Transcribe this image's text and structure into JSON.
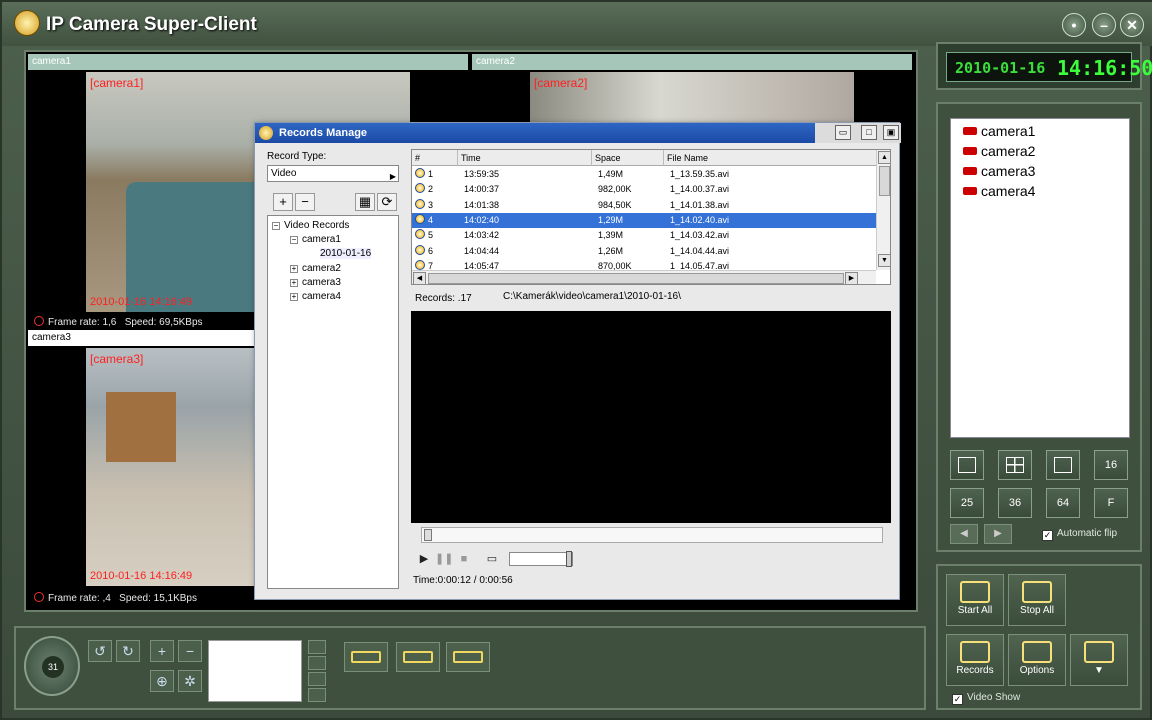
{
  "app": {
    "title": "IP Camera Super-Client"
  },
  "clock": {
    "date": "2010-01-16",
    "time": "14:16:50"
  },
  "cameras": {
    "cam1": {
      "header": "camera1",
      "overlay_label": "[camera1]",
      "timestamp": "2010-01-16 14:16:49",
      "frame_rate": "Frame rate: 1,6",
      "speed": "Speed: 69,5KBps"
    },
    "cam2": {
      "header": "camera2",
      "overlay_label": "[camera2]"
    },
    "cam3": {
      "header": "camera3",
      "overlay_label": "[camera3]",
      "timestamp": "2010-01-16 14:16:49",
      "frame_rate": "Frame rate: ,4",
      "speed": "Speed: 15,1KBps"
    }
  },
  "camera_list": [
    "camera1",
    "camera2",
    "camera3",
    "camera4"
  ],
  "layout_buttons": {
    "b16": "16",
    "b25": "25",
    "b36": "36",
    "b64": "64",
    "bf": "F"
  },
  "automatic_flip": "Automatic flip",
  "actions": {
    "start_all": "Start All",
    "stop_all": "Stop All",
    "records": "Records",
    "options": "Options"
  },
  "video_show": "Video Show",
  "ptz_center": "31",
  "dialog": {
    "title": "Records Manage",
    "record_type_label": "Record Type:",
    "record_type_value": "Video",
    "tree": {
      "root": "Video Records",
      "camera1": "camera1",
      "date": "2010-01-16",
      "camera2": "camera2",
      "camera3": "camera3",
      "camera4": "camera4"
    },
    "columns": {
      "num": "#",
      "time": "Time",
      "space": "Space",
      "file": "File Name"
    },
    "records": [
      {
        "n": "1",
        "time": "13:59:35",
        "space": "1,49M",
        "file": "1_13.59.35.avi"
      },
      {
        "n": "2",
        "time": "14:00:37",
        "space": "982,00K",
        "file": "1_14.00.37.avi"
      },
      {
        "n": "3",
        "time": "14:01:38",
        "space": "984,50K",
        "file": "1_14.01.38.avi"
      },
      {
        "n": "4",
        "time": "14:02:40",
        "space": "1,29M",
        "file": "1_14.02.40.avi"
      },
      {
        "n": "5",
        "time": "14:03:42",
        "space": "1,39M",
        "file": "1_14.03.42.avi"
      },
      {
        "n": "6",
        "time": "14:04:44",
        "space": "1,26M",
        "file": "1_14.04.44.avi"
      },
      {
        "n": "7",
        "time": "14:05:47",
        "space": "870,00K",
        "file": "1_14.05.47.avi"
      }
    ],
    "records_count": "Records: .17",
    "path": "C:\\Kamerák\\video\\camera1\\2010-01-16\\",
    "time_readout": "Time:0:00:12 / 0:00:56"
  },
  "colors": {
    "accent": "#3572d8",
    "overlay_red": "#ff2020",
    "clock_green": "#3aff3a",
    "chrome": "#3f503f"
  }
}
